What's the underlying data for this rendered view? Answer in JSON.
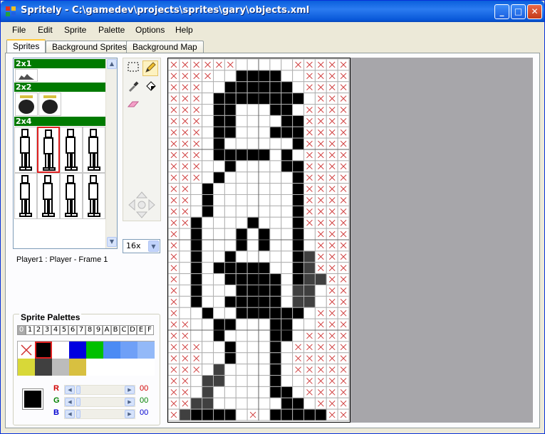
{
  "window": {
    "title": "Spritely - C:\\gamedev\\projects\\sprites\\gary\\objects.xml",
    "minimize_glyph": "_",
    "maximize_glyph": "□",
    "close_glyph": "✕"
  },
  "menu": {
    "items": [
      {
        "label": "File"
      },
      {
        "label": "Edit"
      },
      {
        "label": "Sprite"
      },
      {
        "label": "Palette"
      },
      {
        "label": "Options"
      },
      {
        "label": "Help"
      }
    ]
  },
  "tabs": [
    {
      "label": "Sprites",
      "active": true
    },
    {
      "label": "Background Sprites",
      "active": false
    },
    {
      "label": "Background Map",
      "active": false
    }
  ],
  "sprite_list": {
    "groups": [
      {
        "label": "2x1"
      },
      {
        "label": "2x2"
      },
      {
        "label": "2x4"
      }
    ],
    "selected_caption": "Player1 : Player - Frame 1"
  },
  "tools": {
    "icons": [
      "marquee-select-icon",
      "pencil-icon",
      "eyedropper-icon",
      "paint-bucket-icon",
      "eraser-icon",
      "move-arrows-icon"
    ],
    "active": "pencil-icon"
  },
  "zoom": {
    "value": "16x"
  },
  "palettes": {
    "title": "Sprite Palettes",
    "tabs": [
      "0",
      "1",
      "2",
      "3",
      "4",
      "5",
      "6",
      "7",
      "8",
      "9",
      "A",
      "B",
      "C",
      "D",
      "E",
      "F"
    ],
    "active_tab": "0",
    "swatches_row1": [
      "transparent",
      "#000000",
      "#ffffff",
      "#0000e0",
      "#00c000",
      "#4b8bf4",
      "#6fa0f7",
      "#93b9f8"
    ],
    "swatches_row2": [
      "#d8d838",
      "#404040",
      "#bcbcbc",
      "#d8c040",
      "#ffffff",
      "#ffffff",
      "#ffffff",
      "#ffffff"
    ],
    "selected_index": 1,
    "current_color": "#000000",
    "channels": [
      {
        "label": "R",
        "value": "00",
        "color": "#d00000"
      },
      {
        "label": "G",
        "value": "00",
        "color": "#008000"
      },
      {
        "label": "B",
        "value": "00",
        "color": "#0000d0"
      }
    ]
  },
  "editor": {
    "grid_cols": 16,
    "grid_rows": 32,
    "pixels": [
      "TTTTTTWWWWWTTTTT",
      "TTTTWWKKKKWWTTTT",
      "TTTWWKKKKKKWTTTT",
      "TTTWKKKKKKKKWTTT",
      "TTTWKKWWWKKWTTTT",
      "TTTWKKWWWWKKTTTT",
      "TTTWKKWWWKKKTTTT",
      "TTTWKWWWWWWKTTTT",
      "TTTWKKKKKWKWTTTT",
      "TTTWWKWWWWKKTTTT",
      "TTTWKWWWWWWKTTTT",
      "TTWKWWWWWWWKTTTT",
      "TTWKWWWWWWWKTTTT",
      "TTWKWWWWWWWKTTTT",
      "TTKWWWWKWWWKTTTT",
      "TWKWWWKWKWWKWTTT",
      "TWKWWWKWKWWKWTTT",
      "TWKWWKWWWWWKGTTT",
      "TWKWKKKKKWWKGTTT",
      "TWKWWKKKKKWKGGTT",
      "TWKWWWKKKKWGGWTT",
      "TWKWWKKKKKWGGWTT",
      "TWWKWWKKKKKKWTTT",
      "TTWWKKWWWKKWWTTT",
      "TTWWKWWWWKKWTTTT",
      "TTTWWKWWWKWTTTTT",
      "TTTWWKWWWKWTTTTT",
      "TTTWGWWWWKWTTTTT",
      "TTWGGWWWWKWWTTTT",
      "TTWGWWWWWKKWTTTT",
      "TTGGWWWWWWKKWTTT",
      "TGKKKKWTWKKKKKTT"
    ]
  }
}
